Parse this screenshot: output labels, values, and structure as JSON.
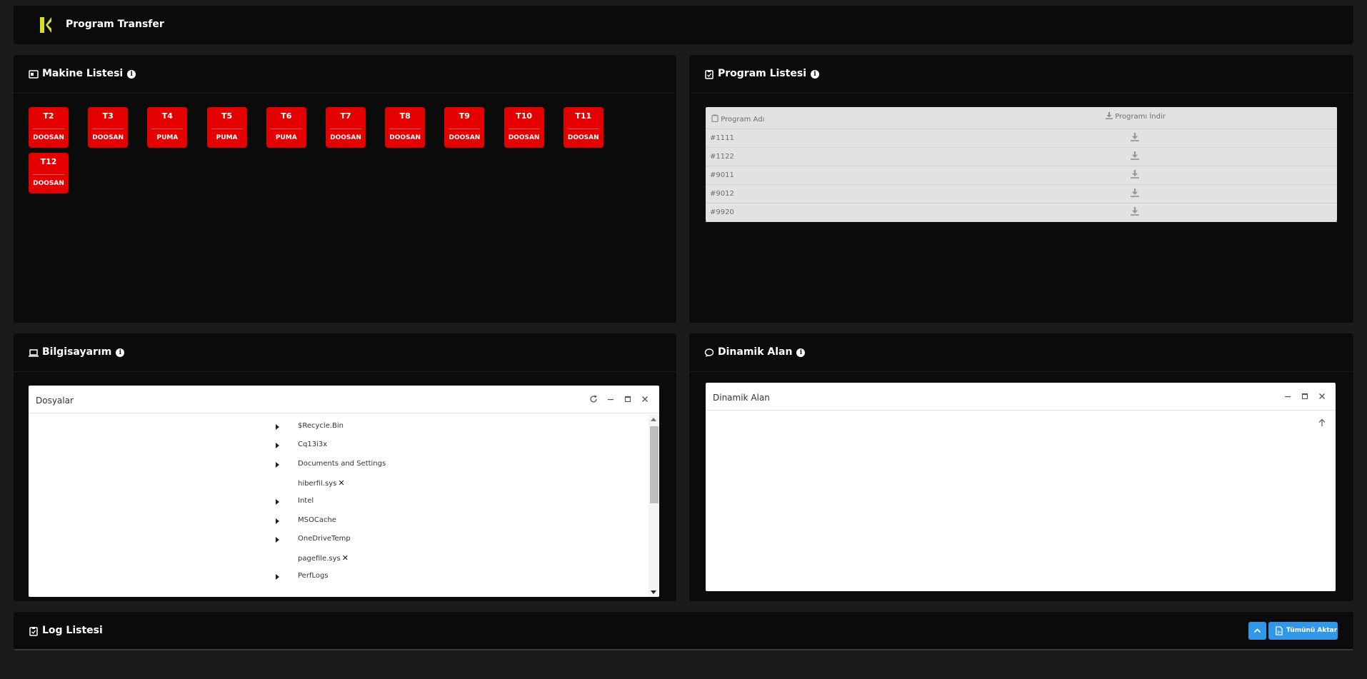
{
  "app": {
    "title": "Program Transfer"
  },
  "machine_list": {
    "title": "Makine Listesi",
    "machines": [
      {
        "name": "T2",
        "brand": "DOOSAN"
      },
      {
        "name": "T3",
        "brand": "DOOSAN"
      },
      {
        "name": "T4",
        "brand": "PUMA"
      },
      {
        "name": "T5",
        "brand": "PUMA"
      },
      {
        "name": "T6",
        "brand": "PUMA"
      },
      {
        "name": "T7",
        "brand": "DOOSAN"
      },
      {
        "name": "T8",
        "brand": "DOOSAN"
      },
      {
        "name": "T9",
        "brand": "DOOSAN"
      },
      {
        "name": "T10",
        "brand": "DOOSAN"
      },
      {
        "name": "T11",
        "brand": "DOOSAN"
      },
      {
        "name": "T12",
        "brand": "DOOSAN"
      }
    ]
  },
  "program_list": {
    "title": "Program Listesi",
    "col_name": "Program Adı",
    "col_download": "Programı İndir",
    "rows": [
      "#1111",
      "#1122",
      "#9011",
      "#9012",
      "#9920"
    ]
  },
  "computer": {
    "title": "Bilgisayarım",
    "window_title": "Dosyalar",
    "files": [
      {
        "name": "$Recycle.Bin",
        "folder": true
      },
      {
        "name": "Cq13i3x",
        "folder": true
      },
      {
        "name": "Documents and Settings",
        "folder": true
      },
      {
        "name": "hiberfil.sys",
        "folder": false
      },
      {
        "name": "Intel",
        "folder": true
      },
      {
        "name": "MSOCache",
        "folder": true
      },
      {
        "name": "OneDriveTemp",
        "folder": true
      },
      {
        "name": "pagefile.sys",
        "folder": false
      },
      {
        "name": "PerfLogs",
        "folder": true
      }
    ],
    "delete_glyph": "✕"
  },
  "dynamic": {
    "title": "Dinamik Alan",
    "window_title": "Dinamik Alan"
  },
  "log": {
    "title": "Log Listesi",
    "export_label": "Tümünü Aktar"
  },
  "colors": {
    "background": "#1c1b1c",
    "panel": "#0b0b0b",
    "machine": "#e50000",
    "accent_blue": "#3197e8",
    "logo": "#d9e021"
  }
}
